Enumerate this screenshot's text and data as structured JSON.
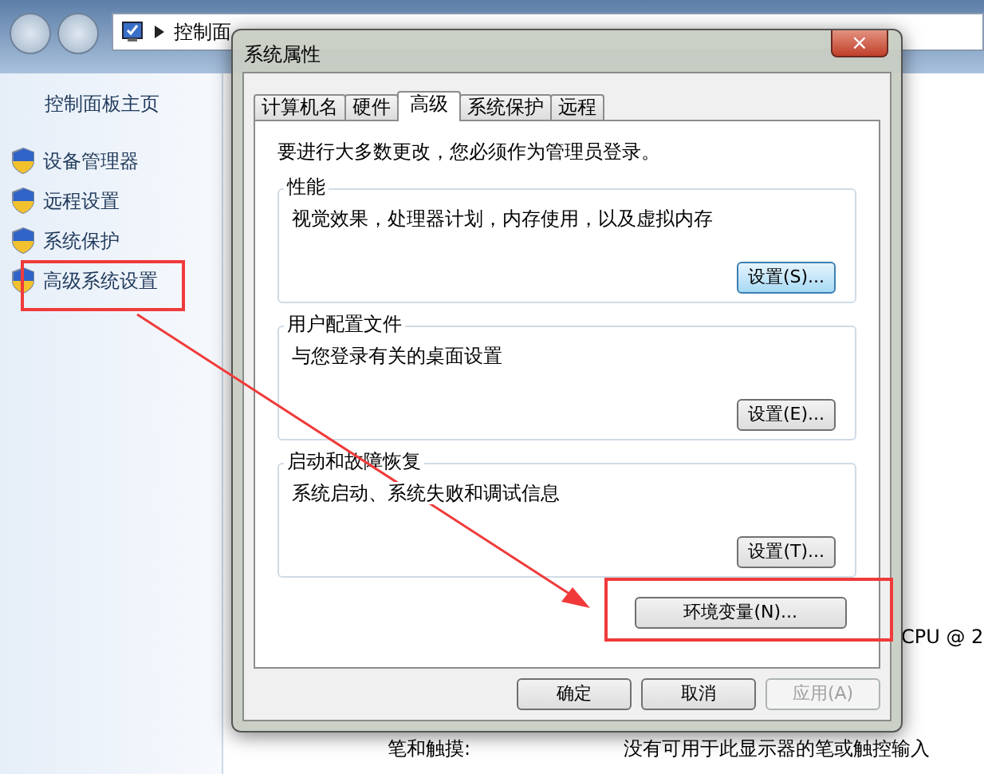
{
  "explorer": {
    "breadcrumb": "控制面",
    "sidebar": {
      "home": "控制面板主页",
      "items": [
        {
          "label": "设备管理器",
          "annotated": false
        },
        {
          "label": "远程设置",
          "annotated": false
        },
        {
          "label": "系统保护",
          "annotated": false
        },
        {
          "label": "高级系统设置",
          "annotated": true
        }
      ]
    },
    "details": {
      "cpu_text": "CPU @ 2",
      "pen_label": "笔和触摸:",
      "pen_value": "没有可用于此显示器的笔或触控输入"
    }
  },
  "dialog": {
    "title": "系统属性",
    "close": "×",
    "tabs": [
      {
        "label": "计算机名",
        "selected": false
      },
      {
        "label": "硬件",
        "selected": false
      },
      {
        "label": "高级",
        "selected": true
      },
      {
        "label": "系统保护",
        "selected": false
      },
      {
        "label": "远程",
        "selected": false
      }
    ],
    "notice": "要进行大多数更改，您必须作为管理员登录。",
    "groups": [
      {
        "title": "性能",
        "description": "视觉效果，处理器计划，内存使用，以及虚拟内存",
        "button": "设置(S)...",
        "focused": true
      },
      {
        "title": "用户配置文件",
        "description": "与您登录有关的桌面设置",
        "button": "设置(E)...",
        "focused": false
      },
      {
        "title": "启动和故障恢复",
        "description": "系统启动、系统失败和调试信息",
        "button": "设置(T)...",
        "focused": false
      }
    ],
    "env_button": {
      "label": "环境变量(N)...",
      "annotated": true
    },
    "buttons": [
      {
        "label": "确定",
        "disabled": false
      },
      {
        "label": "取消",
        "disabled": false
      },
      {
        "label": "应用(A)",
        "disabled": true
      }
    ]
  }
}
